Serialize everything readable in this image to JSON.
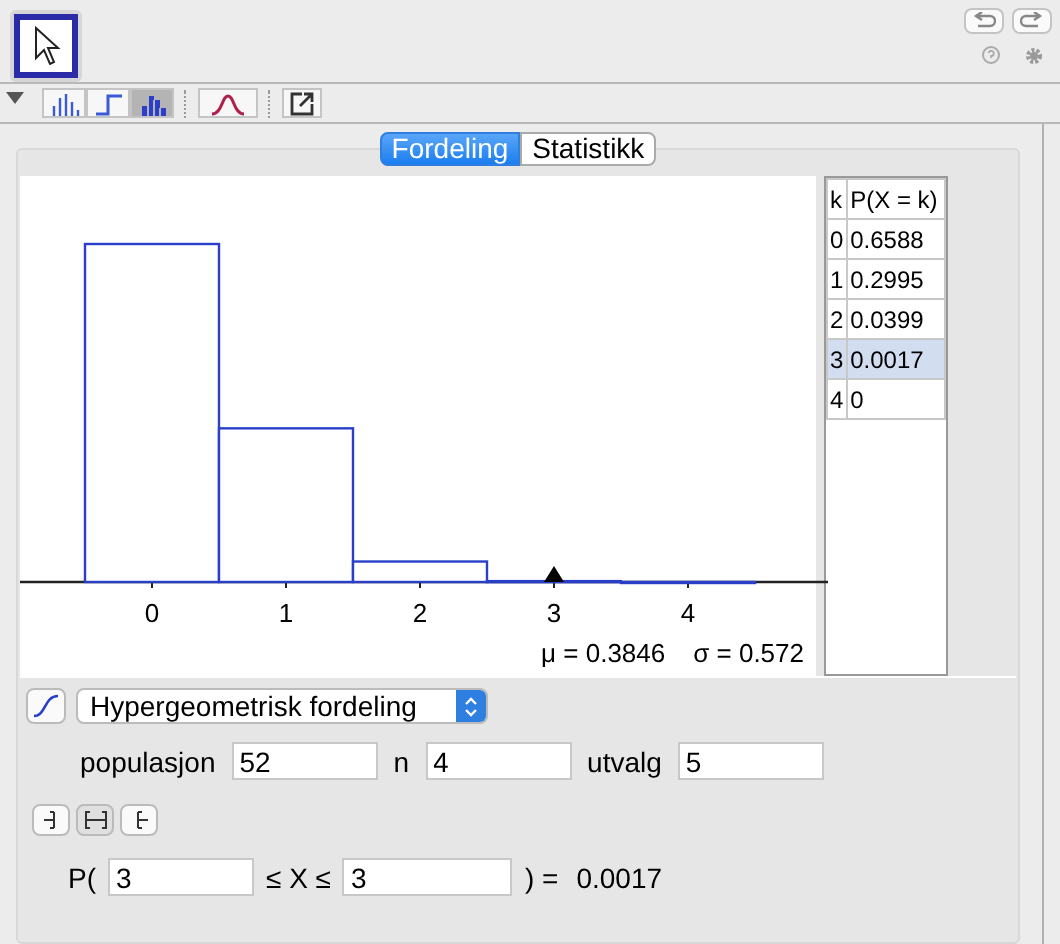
{
  "view_buttons": [
    {
      "kind": "bars",
      "selected": false
    },
    {
      "kind": "step",
      "selected": false
    },
    {
      "kind": "histogram",
      "selected": true
    }
  ],
  "tabs": [
    {
      "label": "Fordeling",
      "selected": true
    },
    {
      "label": "Statistikk",
      "selected": false
    }
  ],
  "chart": {
    "x_labels": [
      "0",
      "1",
      "2",
      "3",
      "4"
    ],
    "mean": "μ = 0.3846",
    "sd": "σ = 0.572"
  },
  "table": {
    "columns": [
      "k",
      "P(X = k)"
    ],
    "rows": [
      {
        "cells": [
          "0",
          "0.6588"
        ],
        "selected": false
      },
      {
        "cells": [
          "1",
          "0.2995"
        ],
        "selected": false
      },
      {
        "cells": [
          "2",
          "0.0399"
        ],
        "selected": false
      },
      {
        "cells": [
          "3",
          "0.0017"
        ],
        "selected": true
      },
      {
        "cells": [
          "4",
          "0"
        ],
        "selected": false
      }
    ]
  },
  "distribution": "Hypergeometrisk fordeling",
  "parameters": [
    {
      "label": "populasjon",
      "value": "52"
    },
    {
      "label": "n",
      "value": "4"
    },
    {
      "label": "utvalg",
      "value": "5"
    }
  ],
  "interval_buttons": [
    {
      "kind": "left",
      "selected": false
    },
    {
      "kind": "interval",
      "selected": true
    },
    {
      "kind": "right",
      "selected": false
    }
  ],
  "probability": {
    "prefix": "P(",
    "low": "3",
    "middle": "≤ X ≤",
    "high": "3",
    "suffix": ") =",
    "result": "0.0017"
  }
}
